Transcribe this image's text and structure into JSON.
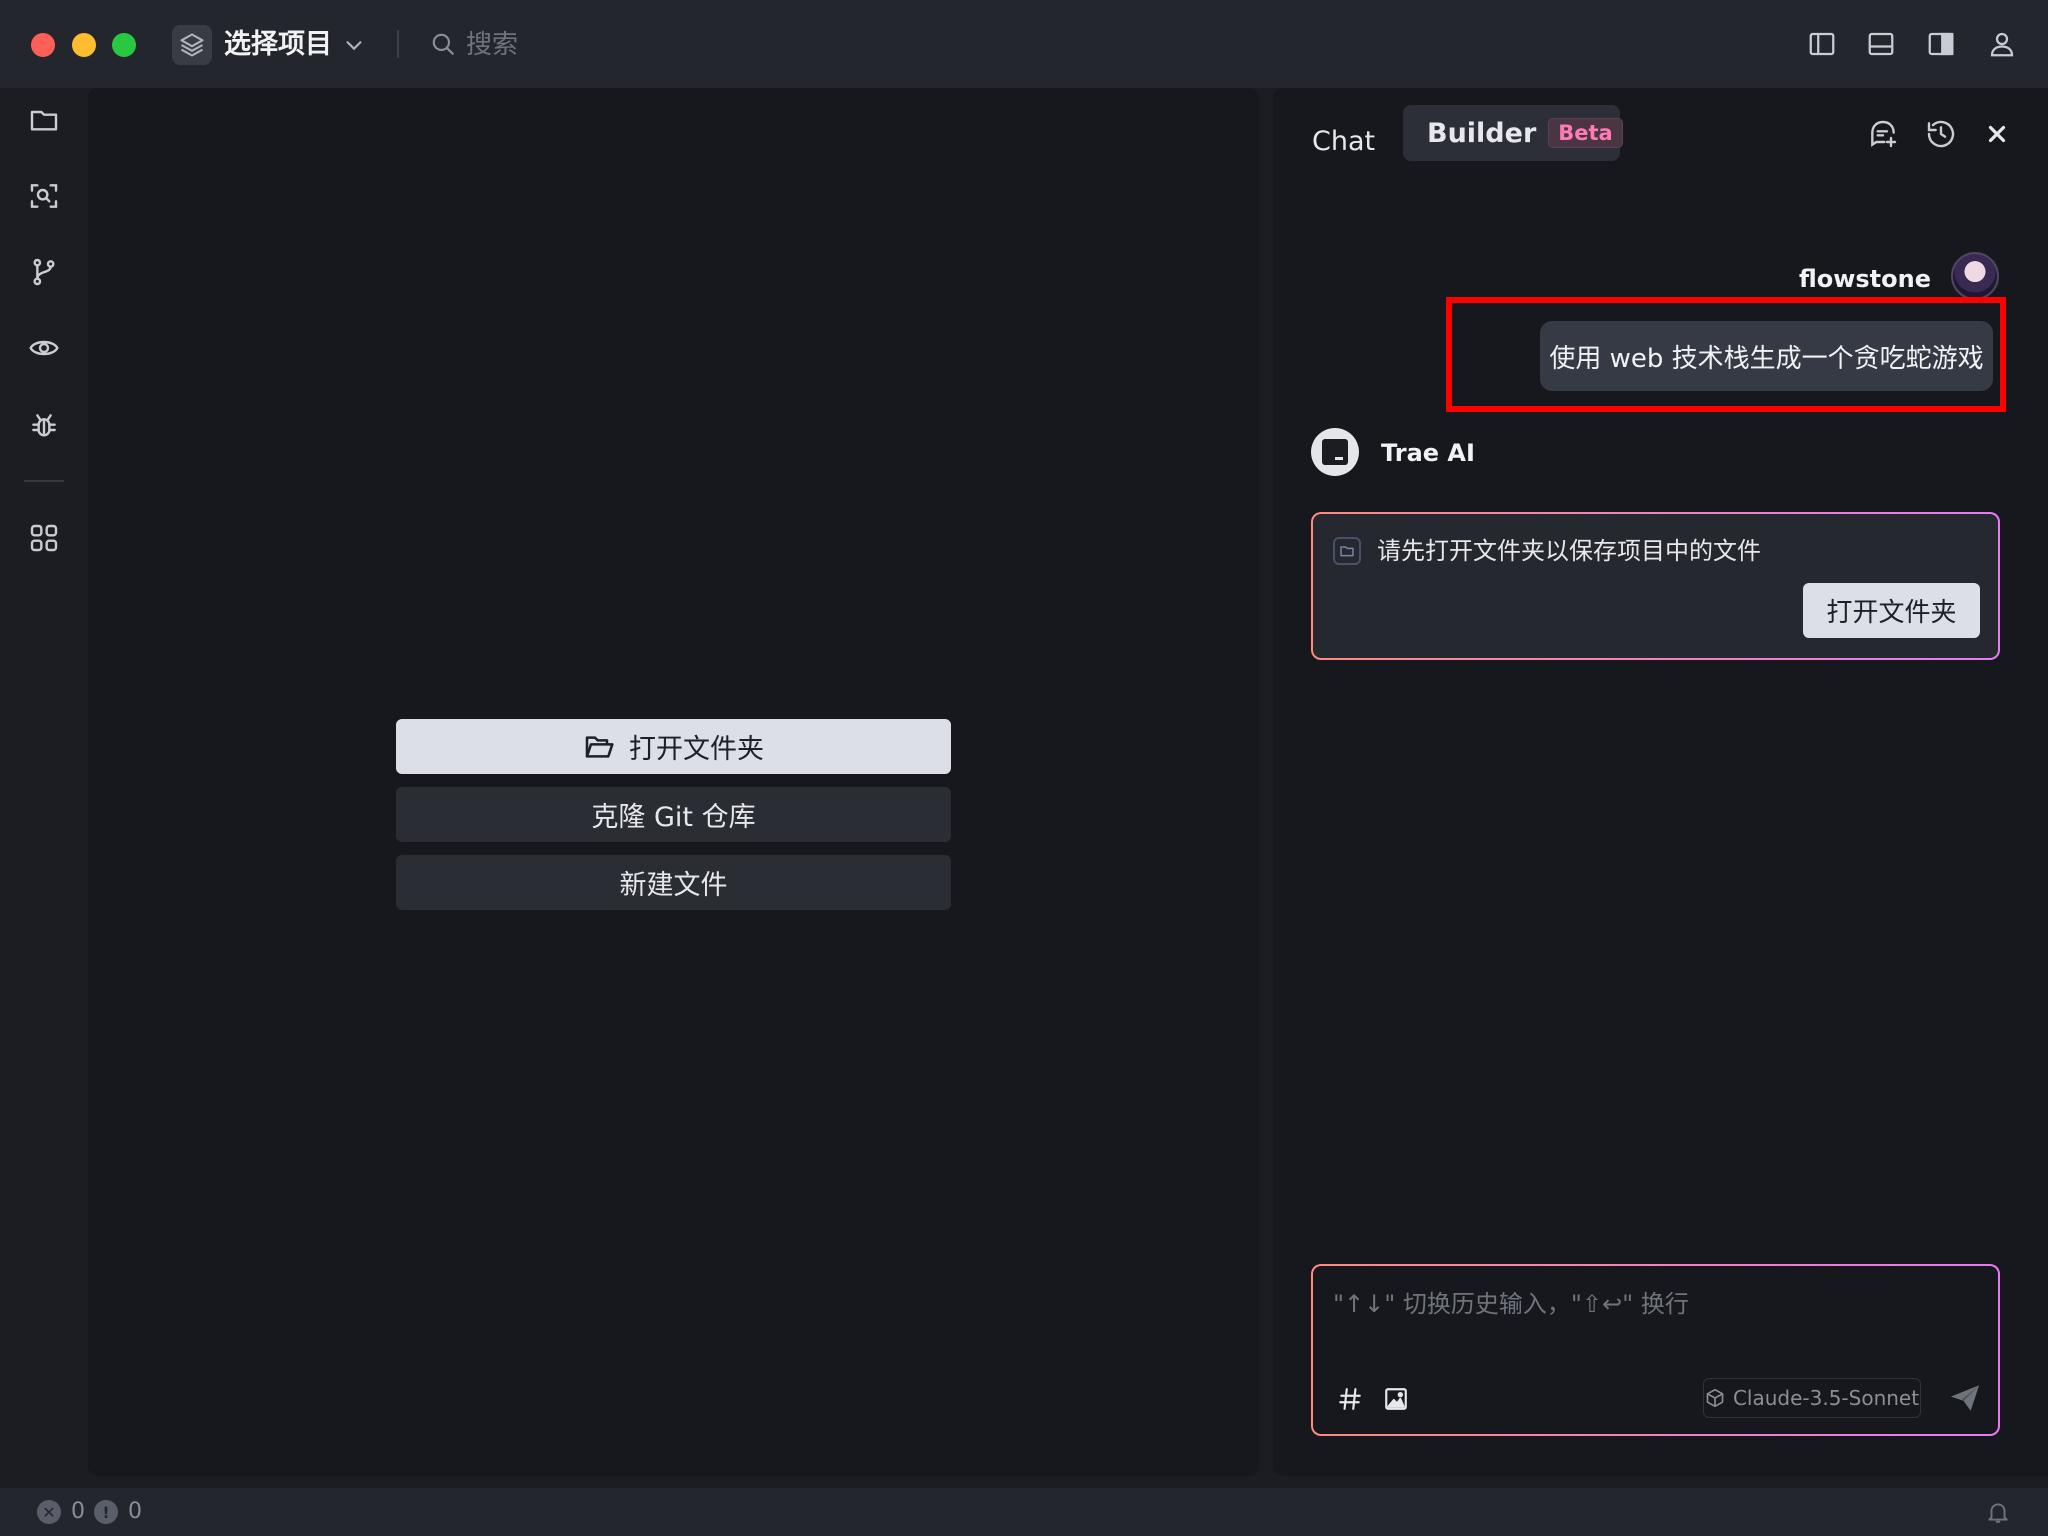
{
  "titlebar": {
    "project_label": "选择项目",
    "search_placeholder": "搜索"
  },
  "editor": {
    "open_folder_label": "打开文件夹",
    "clone_git_label": "克隆 Git 仓库",
    "new_file_label": "新建文件"
  },
  "chat": {
    "tabs": {
      "chat_label": "Chat",
      "builder_label": "Builder",
      "beta_badge": "Beta"
    },
    "user": {
      "name": "flowstone",
      "message": "使用 web 技术栈生成一个贪吃蛇游戏"
    },
    "ai": {
      "name": "Trae AI",
      "notice_text": "请先打开文件夹以保存项目中的文件",
      "notice_button": "打开文件夹"
    },
    "input": {
      "placeholder": "\"↑↓\" 切换历史输入，\"⇧↩\" 换行",
      "model": "Claude-3.5-Sonnet"
    }
  },
  "statusbar": {
    "errors": "0",
    "warnings": "0"
  },
  "colors": {
    "accent_pink": "#ff7ab6",
    "highlight_red": "#ff0000",
    "traffic_red": "#fe5f57",
    "traffic_yellow": "#febc2e",
    "traffic_green": "#28c840"
  },
  "icons": {
    "titlebar": [
      "layers-icon",
      "chevron-down-icon",
      "search-icon",
      "layout-sidebar-left-icon",
      "layout-panel-bottom-icon",
      "layout-sidebar-right-icon",
      "account-icon"
    ],
    "activity": [
      "folder-icon",
      "search-code-icon",
      "git-branch-icon",
      "eye-icon",
      "bug-icon",
      "extensions-grid-icon"
    ],
    "chat_header": [
      "new-chat-icon",
      "history-icon",
      "close-icon"
    ],
    "input": [
      "hash-icon",
      "image-icon",
      "cube-icon",
      "send-icon"
    ],
    "statusbar": [
      "error-icon",
      "warning-icon",
      "bell-icon"
    ]
  }
}
